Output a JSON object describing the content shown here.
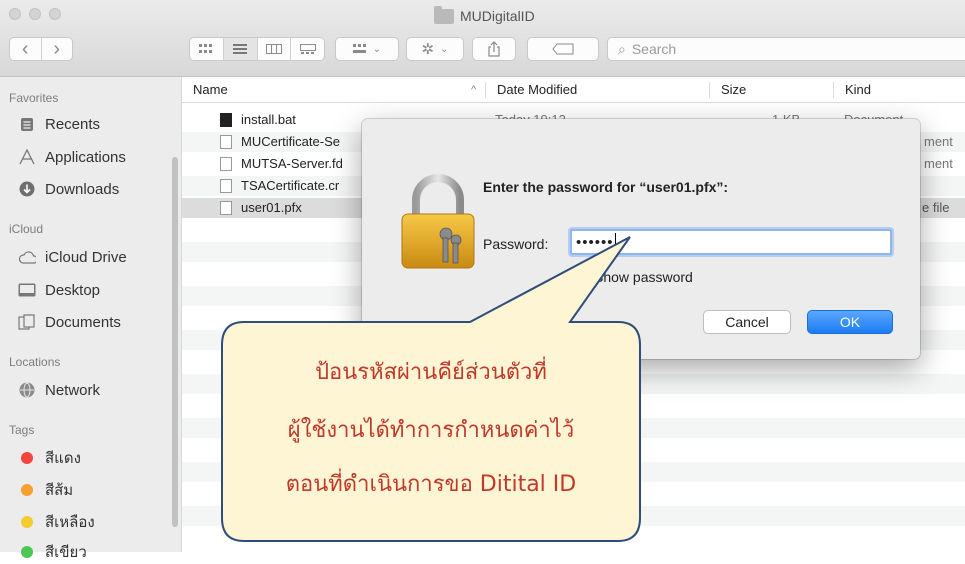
{
  "window": {
    "title": "MUDigitalID"
  },
  "toolbar": {
    "back": "‹",
    "forward": "›",
    "search_placeholder": "Search"
  },
  "sidebar": {
    "favorites_header": "Favorites",
    "favorites": [
      {
        "label": "Recents",
        "icon": "recents-icon"
      },
      {
        "label": "Applications",
        "icon": "applications-icon"
      },
      {
        "label": "Downloads",
        "icon": "downloads-icon"
      }
    ],
    "icloud_header": "iCloud",
    "icloud": [
      {
        "label": "iCloud Drive",
        "icon": "cloud-icon"
      },
      {
        "label": "Desktop",
        "icon": "desktop-icon"
      },
      {
        "label": "Documents",
        "icon": "documents-icon"
      }
    ],
    "locations_header": "Locations",
    "locations": [
      {
        "label": "Network",
        "icon": "network-icon"
      }
    ],
    "tags_header": "Tags",
    "tags": [
      {
        "label": "สีแดง",
        "color": "#f2463d"
      },
      {
        "label": "สีส้ม",
        "color": "#f5a02f"
      },
      {
        "label": "สีเหลือง",
        "color": "#f6cb2e"
      },
      {
        "label": "สีเขียว",
        "color": "#4bc753"
      }
    ]
  },
  "columns": {
    "name": "Name",
    "date": "Date Modified",
    "size": "Size",
    "kind": "Kind"
  },
  "files": [
    {
      "name": "install.bat",
      "date": "Today 19:12",
      "size": "1 KB",
      "kind": "Document"
    },
    {
      "name": "MUCertificate-Se",
      "date": "",
      "size": "",
      "kind": "ment"
    },
    {
      "name": "MUTSA-Server.fd",
      "date": "",
      "size": "",
      "kind": "ment"
    },
    {
      "name": "TSACertificate.cr",
      "date": "",
      "size": "",
      "kind": ""
    },
    {
      "name": "user01.pfx",
      "date": "",
      "size": "",
      "kind": "e file"
    }
  ],
  "dialog": {
    "prompt": "Enter the password for “user01.pfx”:",
    "password_label": "Password:",
    "password_value": "••••••",
    "show_password_label": "Show password",
    "cancel_label": "Cancel",
    "ok_label": "OK"
  },
  "callout": {
    "line1": "ป้อนรหัสผ่านคีย์ส่วนตัวที่",
    "line2": "ผู้ใช้งานได้ทำการกำหนดค่าไว้",
    "line3": "ตอนที่ดำเนินการขอ Ditital ID"
  }
}
